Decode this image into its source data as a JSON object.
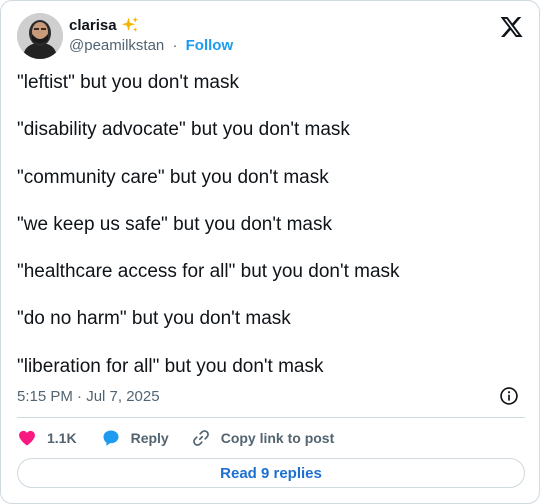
{
  "user": {
    "display_name": "clarisa",
    "emoji": "sparkles-icon",
    "handle": "@peamilkstan",
    "separator": "·",
    "follow_label": "Follow"
  },
  "tweet": {
    "lines": [
      "\"leftist\" but you don't mask",
      "\"disability advocate\" but you don't mask",
      "\"community care\" but you don't mask",
      "\"we keep us safe\" but you don't mask",
      "\"healthcare access for all\" but you don't mask",
      "\"do no harm\" but you don't mask",
      "\"liberation for all\" but you don't mask"
    ],
    "timestamp": "5:15 PM · Jul 7, 2025"
  },
  "actions": {
    "like_count": "1.1K",
    "reply_label": "Reply",
    "copy_label": "Copy link to post"
  },
  "read_replies_label": "Read 9 replies",
  "colors": {
    "accent": "#1d9bf0",
    "like": "#f91880",
    "muted": "#536471",
    "border": "#cfd9de"
  }
}
